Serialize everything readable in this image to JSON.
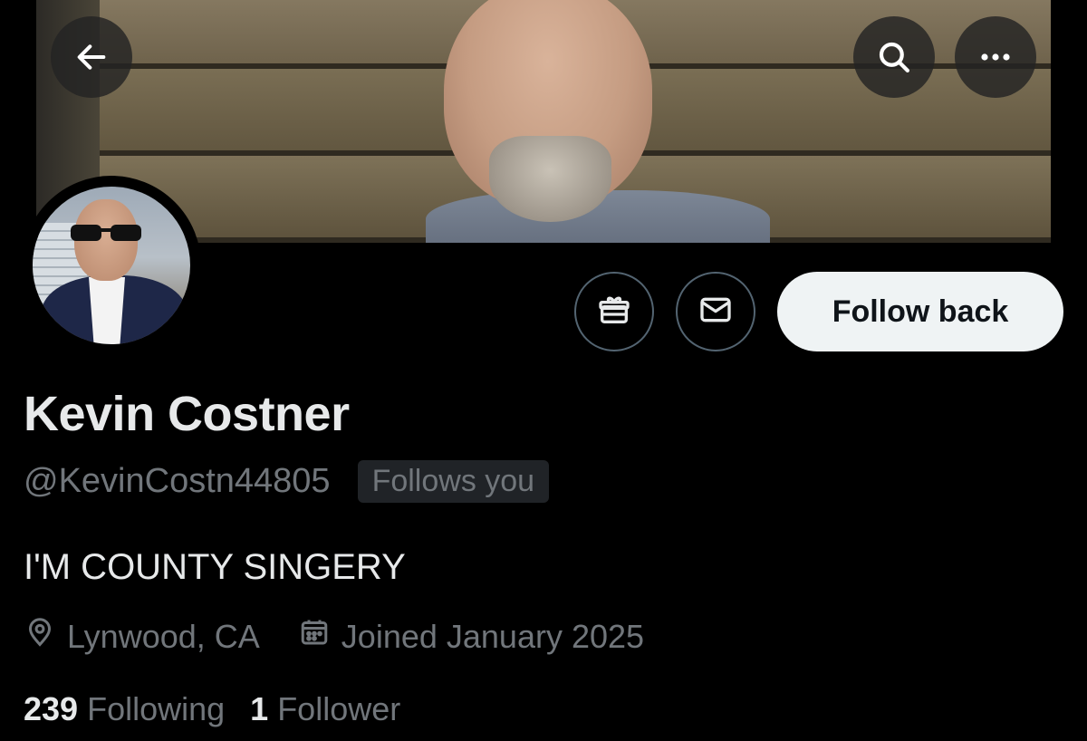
{
  "header": {
    "back_icon": "arrow-left-icon",
    "search_icon": "search-icon",
    "more_icon": "more-horizontal-icon"
  },
  "actions": {
    "gift_icon": "gift-icon",
    "message_icon": "mail-icon",
    "follow_label": "Follow back"
  },
  "profile": {
    "display_name": "Kevin Costner",
    "handle": "@KevinCostn44805",
    "follows_you_badge": "Follows you",
    "bio": "I'M COUNTY SINGERY",
    "location": "Lynwood, CA",
    "joined": "Joined January 2025"
  },
  "stats": {
    "following_count": "239",
    "following_label": "Following",
    "followers_count": "1",
    "followers_label": "Follower"
  },
  "colors": {
    "background": "#000000",
    "primary_text": "#e7e9ea",
    "secondary_text": "#71767b",
    "follow_button_bg": "#eff3f4",
    "badge_bg": "#202327",
    "icon_button_border": "#536471"
  }
}
